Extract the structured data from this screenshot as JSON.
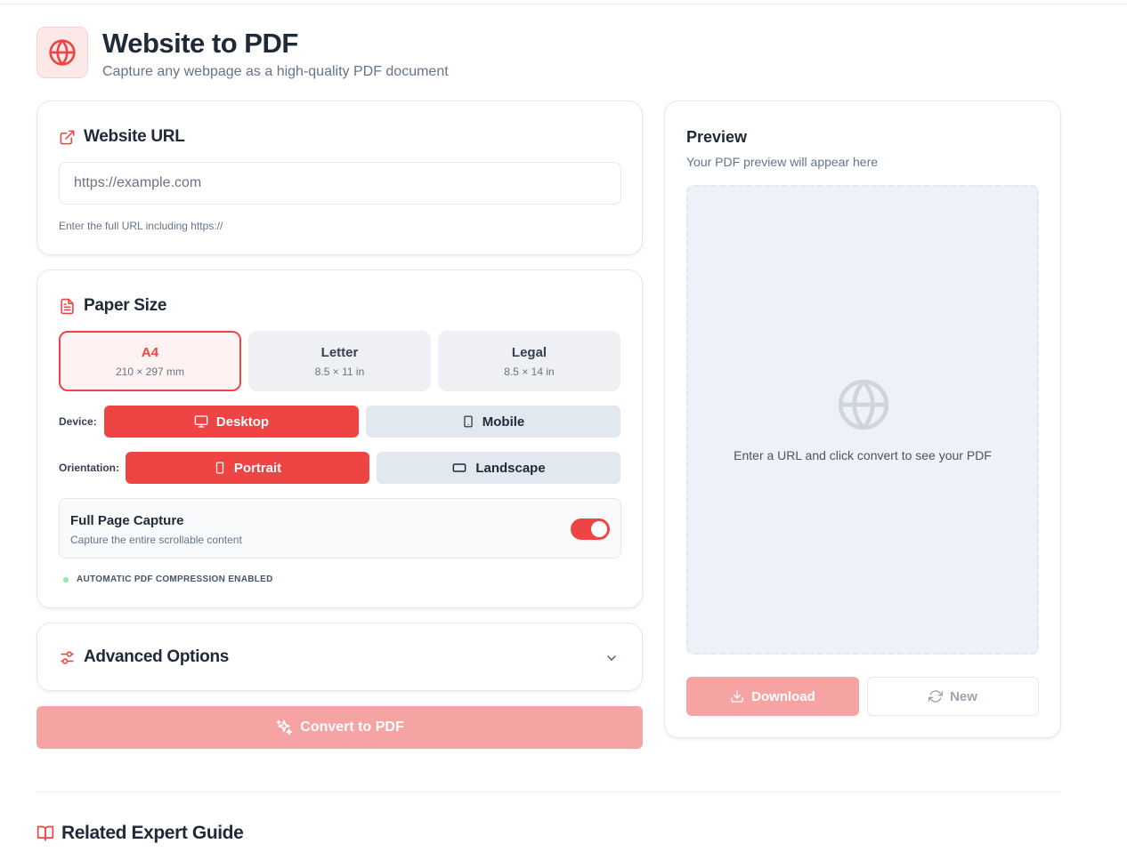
{
  "header": {
    "title": "Website to PDF",
    "subtitle": "Capture any webpage as a high-quality PDF document",
    "logo_icon": "globe-icon"
  },
  "url_card": {
    "title": "Website URL",
    "icon": "external-link-icon",
    "placeholder": "https://example.com",
    "value": "",
    "hint": "Enter the full URL including https://"
  },
  "paper_card": {
    "title": "Paper Size",
    "icon": "document-icon",
    "sizes": [
      {
        "name": "A4",
        "dims": "210 × 297 mm",
        "selected": true
      },
      {
        "name": "Letter",
        "dims": "8.5 × 11 in",
        "selected": false
      },
      {
        "name": "Legal",
        "dims": "8.5 × 14 in",
        "selected": false
      }
    ],
    "device_label": "Device:",
    "devices": [
      {
        "label": "Desktop",
        "icon": "monitor-icon",
        "selected": true
      },
      {
        "label": "Mobile",
        "icon": "smartphone-icon",
        "selected": false
      }
    ],
    "orientation_label": "Orientation:",
    "orientations": [
      {
        "label": "Portrait",
        "icon": "portrait-icon",
        "selected": true
      },
      {
        "label": "Landscape",
        "icon": "landscape-icon",
        "selected": false
      }
    ],
    "full_page": {
      "title": "Full Page Capture",
      "description": "Capture the entire scrollable content",
      "enabled": true
    },
    "compression_note": "AUTOMATIC PDF COMPRESSION ENABLED"
  },
  "advanced": {
    "title": "Advanced Options",
    "icon": "sliders-icon",
    "expanded": false
  },
  "convert_button": "Convert to PDF",
  "preview": {
    "title": "Preview",
    "subtitle": "Your PDF preview will appear here",
    "empty_text": "Enter a URL and click convert to see your PDF",
    "download_label": "Download",
    "new_label": "New"
  },
  "related": {
    "title": "Related Expert Guide",
    "icon": "book-open-icon"
  },
  "colors": {
    "accent": "#ef4444",
    "accent_disabled": "#f5a3a3",
    "muted_bg": "#e2e8f0"
  }
}
